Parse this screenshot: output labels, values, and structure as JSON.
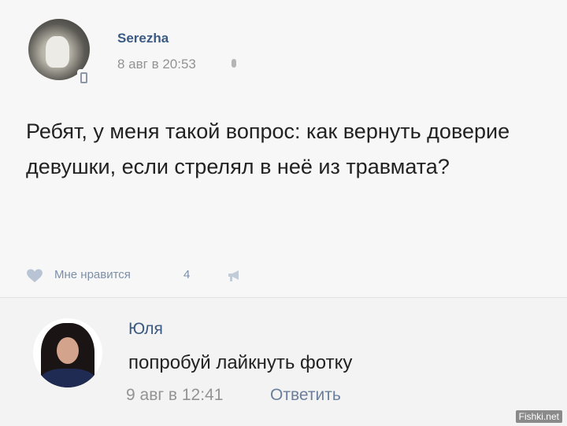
{
  "post": {
    "author": "Serezha",
    "time": "8 авг в 20:53",
    "text": "Ребят, у меня такой вопрос: как вернуть доверие девушки, если стрелял в неё из травмата?",
    "like_label": "Мне нравится",
    "like_count": "4",
    "icons": [
      "mobile-phone-icon",
      "apple-icon",
      "heart-icon",
      "share-megaphone-icon"
    ]
  },
  "comment": {
    "author": "Юля",
    "text": "попробуй лайкнуть фотку",
    "time": "9 авг в 12:41",
    "reply_label": "Ответить"
  },
  "watermark": "Fishki.net",
  "colors": {
    "link": "#3a5a83",
    "meta": "#939393",
    "like": "#7c8fa8",
    "text": "#222222",
    "background": "#f5f5f5"
  }
}
